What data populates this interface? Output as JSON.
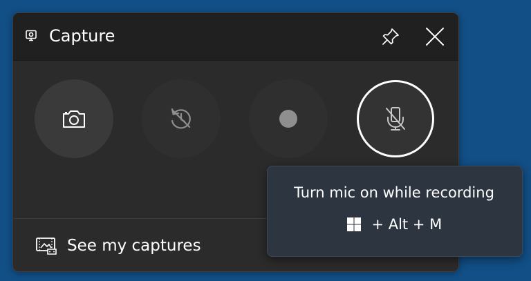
{
  "window": {
    "title": "Capture",
    "title_icon": "capture-widget-icon",
    "pin_icon": "pin-icon",
    "close_icon": "close-icon"
  },
  "actions": [
    {
      "id": "screenshot",
      "icon": "camera-icon"
    },
    {
      "id": "record-last-30-sec",
      "icon": "replay-disabled-icon"
    },
    {
      "id": "start-recording",
      "icon": "record-dot-icon"
    },
    {
      "id": "mic-toggle",
      "icon": "mic-off-icon",
      "focused": true
    }
  ],
  "footer": {
    "label": "See my captures",
    "icon": "gallery-icon"
  },
  "tooltip": {
    "text": "Turn mic on while recording",
    "shortcut": {
      "key_icon": "windows-logo-icon",
      "sep1": " + ",
      "key2": "Alt",
      "sep2": " + ",
      "key3": "M"
    }
  },
  "colors": {
    "desktop": "#124f86",
    "panel": "#2b2b2b",
    "titlebar": "#202020",
    "tooltip": "#2d3541",
    "text": "#ffffff"
  }
}
